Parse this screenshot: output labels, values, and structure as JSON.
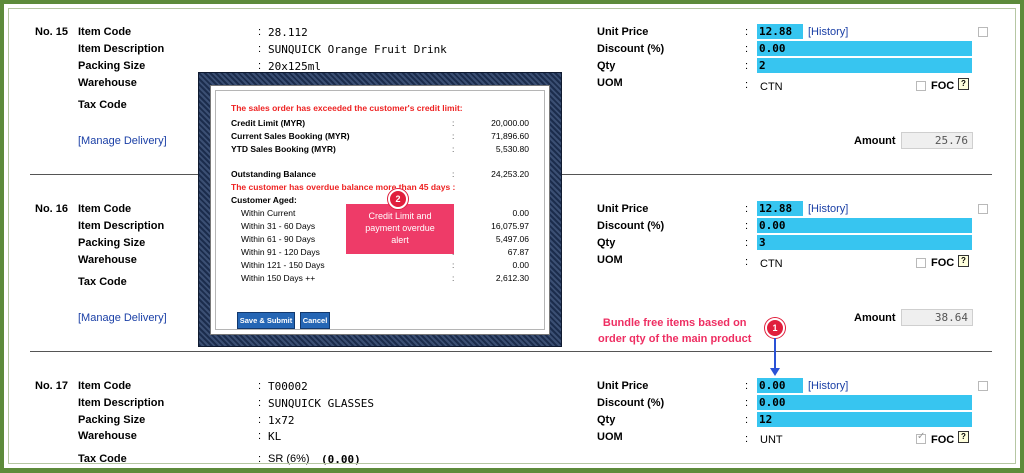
{
  "labels": {
    "item_code": "Item Code",
    "item_description": "Item Description",
    "packing_size": "Packing Size",
    "warehouse": "Warehouse",
    "tax_code": "Tax Code",
    "unit_price": "Unit Price",
    "discount": "Discount (%)",
    "qty": "Qty",
    "uom": "UOM",
    "amount": "Amount",
    "history": "[History]",
    "manage_delivery": "[Manage Delivery]",
    "foc": "FOC",
    "colon": ":"
  },
  "items": [
    {
      "no": "No. 15",
      "item_code": "28.112",
      "item_description": "SUNQUICK Orange Fruit Drink",
      "packing_size": "20x125ml",
      "unit_price": "12.88",
      "discount": "0.00",
      "qty": "2",
      "uom": "CTN",
      "amount": "25.76",
      "foc_checked": false
    },
    {
      "no": "No. 16",
      "item_code": "",
      "unit_price": "12.88",
      "discount": "0.00",
      "qty": "3",
      "uom": "CTN",
      "amount": "38.64",
      "foc_checked": false
    },
    {
      "no": "No. 17",
      "item_code": "T00002",
      "item_description": "SUNQUICK GLASSES",
      "packing_size": "1x72",
      "warehouse": "KL",
      "tax_code": "SR (6%)",
      "tax_amount": "(0.00)",
      "unit_price": "0.00",
      "discount": "0.00",
      "qty": "12",
      "uom": "UNT",
      "foc_checked": true
    }
  ],
  "modal": {
    "exceeded_msg": "The sales order has exceeded the customer's credit limit:",
    "credit_limit_label": "Credit Limit (MYR)",
    "credit_limit": "20,000.00",
    "current_booking_label": "Current Sales Booking (MYR)",
    "current_booking": "71,896.60",
    "ytd_booking_label": "YTD Sales Booking (MYR)",
    "ytd_booking": "5,530.80",
    "outstanding_label": "Outstanding Balance",
    "outstanding": "24,253.20",
    "overdue_msg": "The customer has overdue balance more than 45 days :",
    "aged_label": "Customer Aged:",
    "aged": [
      {
        "label": "Within Current",
        "value": "0.00"
      },
      {
        "label": "Within 31 - 60 Days",
        "value": "16,075.97"
      },
      {
        "label": "Within 61 - 90 Days",
        "value": "5,497.06"
      },
      {
        "label": "Within 91 - 120 Days",
        "value": "67.87"
      },
      {
        "label": "Within 121 - 150 Days",
        "value": "0.00"
      },
      {
        "label": "Within 150 Days ++",
        "value": "2,612.30"
      }
    ],
    "save_submit": "Save & Submit",
    "cancel": "Cancel"
  },
  "callouts": {
    "one_number": "1",
    "one_text_line1": "Bundle free items based on",
    "one_text_line2": "order qty of the main product",
    "two_number": "2",
    "two_text_line1": "Credit Limit and",
    "two_text_line2": "payment overdue",
    "two_text_line3": "alert"
  },
  "colors": {
    "highlight": "#37c5f0",
    "callout": "#ee3b68",
    "badge": "#e01e3c",
    "frame": "#5d8b3a",
    "alert_red": "#ee2222"
  },
  "icons": {
    "help": "help-icon",
    "checkbox": "checkbox-icon"
  }
}
